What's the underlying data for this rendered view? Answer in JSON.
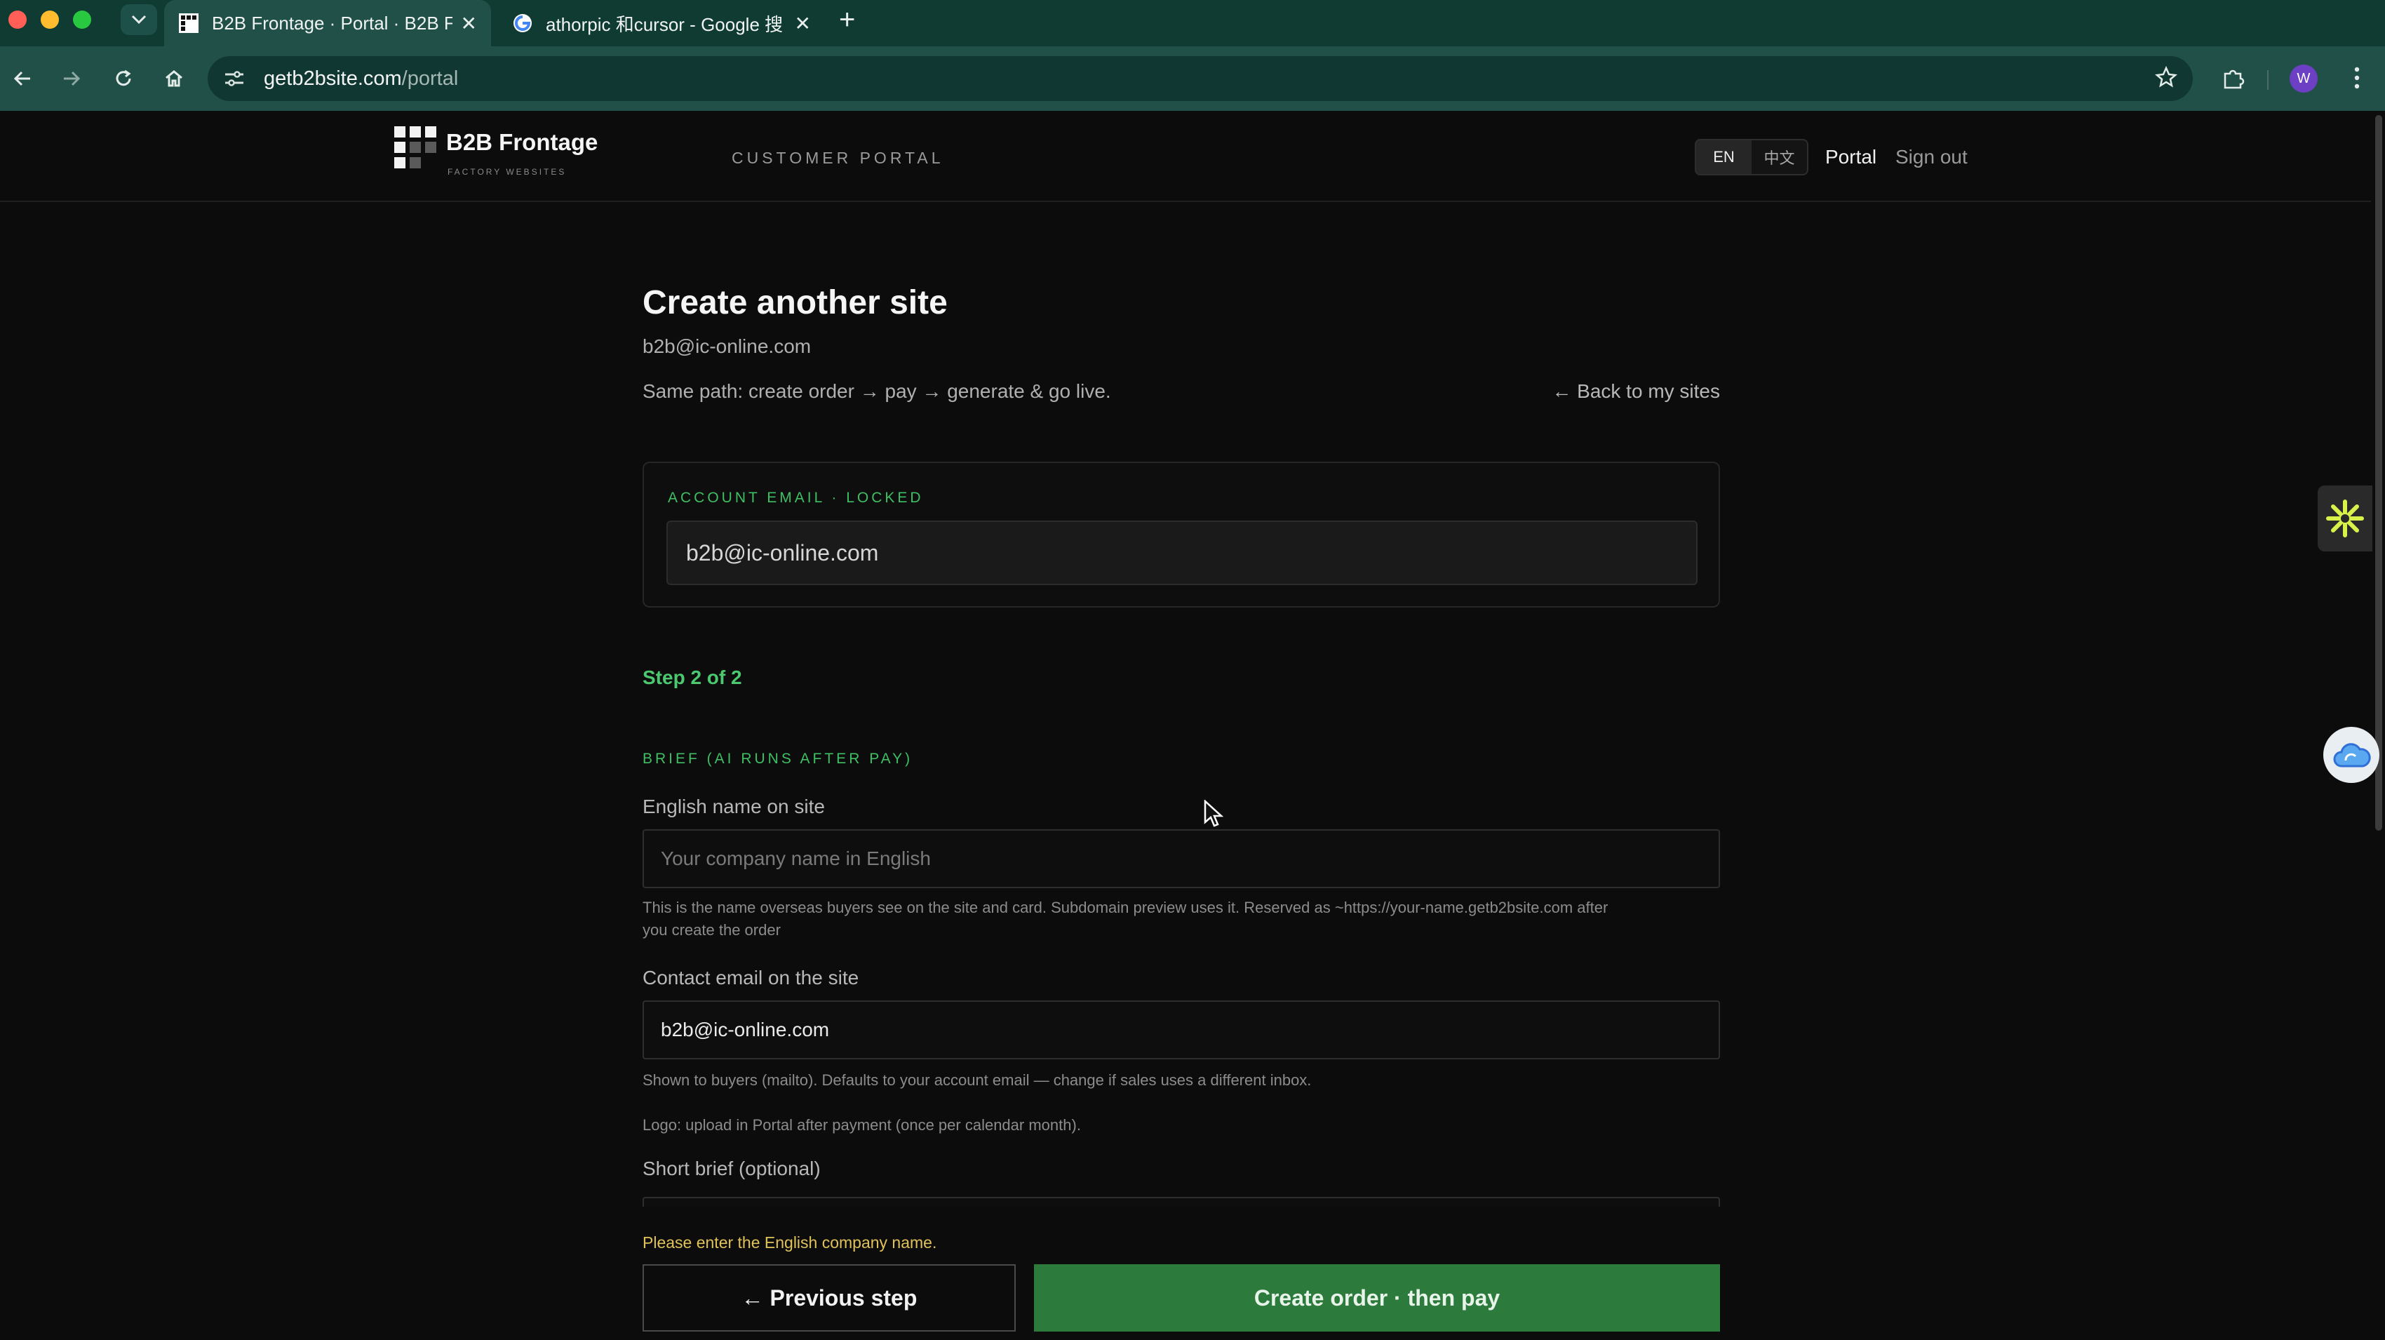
{
  "browser": {
    "tabs": [
      {
        "title": "B2B Frontage · Portal · B2B F",
        "active": true
      },
      {
        "title": "athorpic 和cursor - Google 搜",
        "active": false
      }
    ],
    "url_domain": "getb2bsite.com",
    "url_path": "/portal",
    "profile_initial": "W",
    "close_glyph": "✕",
    "new_tab_glyph": "+"
  },
  "header": {
    "brand_name": "B2B Frontage",
    "brand_tagline": "FACTORY WEBSITES",
    "portal_label": "CUSTOMER PORTAL",
    "languages": [
      "EN",
      "中文"
    ],
    "active_language": "EN",
    "nav_portal": "Portal",
    "nav_signout": "Sign out"
  },
  "page": {
    "title": "Create another site",
    "account_email": "b2b@ic-online.com",
    "path_description": "Same path: create order → pay → generate & go live.",
    "back_link": "← Back to my sites"
  },
  "locked_card": {
    "label": "ACCOUNT EMAIL · LOCKED",
    "value": "b2b@ic-online.com"
  },
  "form": {
    "step": "Step 2 of 2",
    "section_label": "BRIEF (AI RUNS AFTER PAY)",
    "english_name": {
      "label": "English name on site",
      "placeholder": "Your company name in English",
      "help_line1": "This is the name overseas buyers see on the site and card. Subdomain preview uses it. Reserved as ~https://your-name.getb2bsite.com after",
      "help_line2": "you create the order"
    },
    "contact_email": {
      "label": "Contact email on the site",
      "value": "b2b@ic-online.com",
      "help": "Shown to buyers (mailto). Defaults to your account email — change if sales uses a different inbox."
    },
    "logo_note": "Logo: upload in Portal after payment (once per calendar month).",
    "short_brief": {
      "label": "Short brief (optional)"
    },
    "error": "Please enter the English company name.",
    "prev_button": "← Previous step",
    "create_button": "Create order · then pay"
  },
  "colors": {
    "accent_green": "#3fbf63",
    "primary_button": "#2c7a3c",
    "warning": "#e0c25a",
    "chrome": "#215049"
  }
}
